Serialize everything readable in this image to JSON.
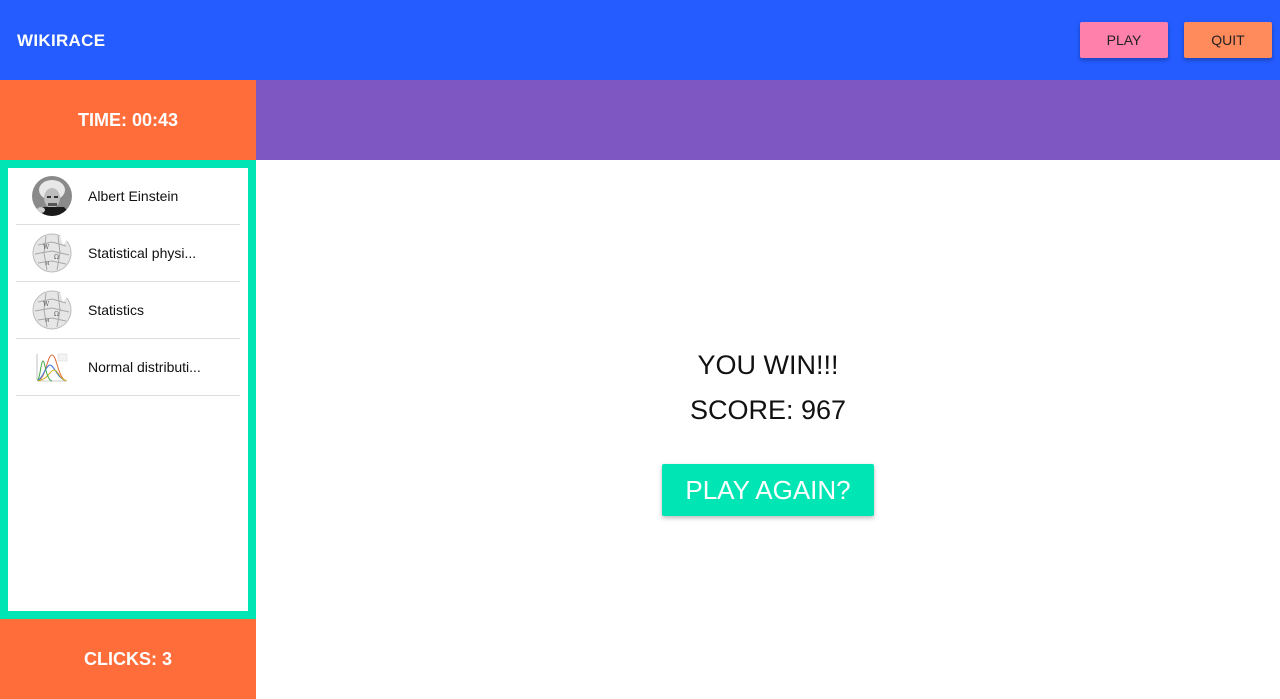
{
  "header": {
    "brand": "WIKIRACE",
    "play_label": "PLAY",
    "quit_label": "QUIT"
  },
  "status": {
    "time_text": "TIME: 00:43",
    "clicks_text": "CLICKS: 3"
  },
  "history": {
    "items": [
      {
        "label": "Albert Einstein",
        "icon": "einstein-photo-icon"
      },
      {
        "label": "Statistical physi...",
        "icon": "wikipedia-globe-icon"
      },
      {
        "label": "Statistics",
        "icon": "wikipedia-globe-icon"
      },
      {
        "label": "Normal distributi...",
        "icon": "normal-distribution-chart-icon"
      }
    ]
  },
  "result": {
    "title": "YOU WIN!!!",
    "score_text": "SCORE: 967",
    "play_again_label": "PLAY AGAIN?"
  },
  "colors": {
    "header": "#245cff",
    "play_button": "#ff80ab",
    "quit_button": "#ff8a5c",
    "orange": "#ff6e3a",
    "purple": "#7e57c2",
    "teal": "#00e5b4"
  }
}
